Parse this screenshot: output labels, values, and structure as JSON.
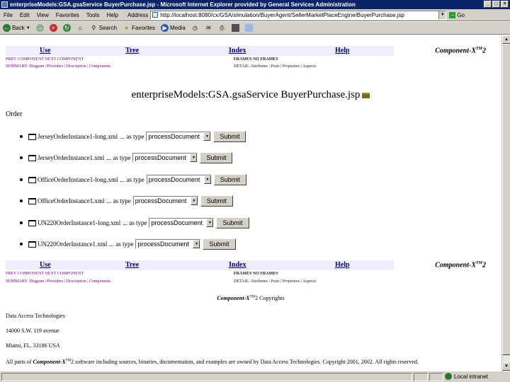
{
  "window": {
    "title": "enterpriseModels:GSA.gsaService BuyerPurchase.jsp - Microsoft Internet Explorer provided by General Services Administration",
    "controls": [
      "_",
      "□",
      "×"
    ]
  },
  "menubar": {
    "items": [
      "File",
      "Edit",
      "View",
      "Favorites",
      "Tools",
      "Help"
    ],
    "address_label": "Address",
    "address_value": "http://localhost:8080/cx/GSA/simulation/BuyerAgent/SellerMarketPlaceEngine/BuyerPurchase.jsp",
    "go_label": "Go"
  },
  "toolbar": {
    "back_label": "Back",
    "search_label": "Search",
    "favorites_label": "Favorites",
    "media_label": "Media"
  },
  "navbar": {
    "use": "Use",
    "tree": "Tree",
    "index": "Index",
    "help": "Help",
    "brand_name": "Component-X",
    "brand_sup": "TM",
    "brand_ver": "2"
  },
  "subnav": {
    "prev_next": "PREV COMPONENT  NEXT COMPONENT",
    "frames": "FRAMES  NO FRAMES",
    "summary": "SUMMARY: Diagram | Providers | Description | Components",
    "detail": "DETAIL: Attributes | Ports | Properties | Aspects"
  },
  "page": {
    "title": "enterpriseModels:GSA.gsaService BuyerPurchase.jsp",
    "section_label": "Order"
  },
  "orders": [
    {
      "file": "JerseyOrderInstance1-long.xml",
      "as_type": "... as type",
      "selected": "processDocument",
      "button": "Submit"
    },
    {
      "file": "JerseyOrderInstance1.xml",
      "as_type": "... as type",
      "selected": "processDocument",
      "button": "Submit"
    },
    {
      "file": "OfficeOrderInstance1-long.xml",
      "as_type": "... as type",
      "selected": "processDocument",
      "button": "Submit"
    },
    {
      "file": "OfficeOrderInstance1.xml",
      "as_type": "... as type",
      "selected": "processDocument",
      "button": "Submit"
    },
    {
      "file": "UN220OrderInstance1-long.xml",
      "as_type": "... as type",
      "selected": "processDocument",
      "button": "Submit"
    },
    {
      "file": "UN220OrderInstance1.xml",
      "as_type": "... as type",
      "selected": "processDocument",
      "button": "Submit"
    }
  ],
  "footer": {
    "copyright_brand": "Component-X",
    "copyright_sup": "TM",
    "copyright_text": "2 Copyrights",
    "company": "Data Access Technologies",
    "street": "14000 S.W. 119 avenue",
    "city": "Miami, FL. 33186 USA",
    "rights_prefix": "All parts of",
    "rights_brand": "Component-X",
    "rights_sup": "TM",
    "rights_text": "2 software including sources, binaries, documentation, and examples are owned by Data Access Technologies. Copyright 2001, 2002. All rights reserved."
  },
  "status": {
    "zone": "Local intranet"
  }
}
